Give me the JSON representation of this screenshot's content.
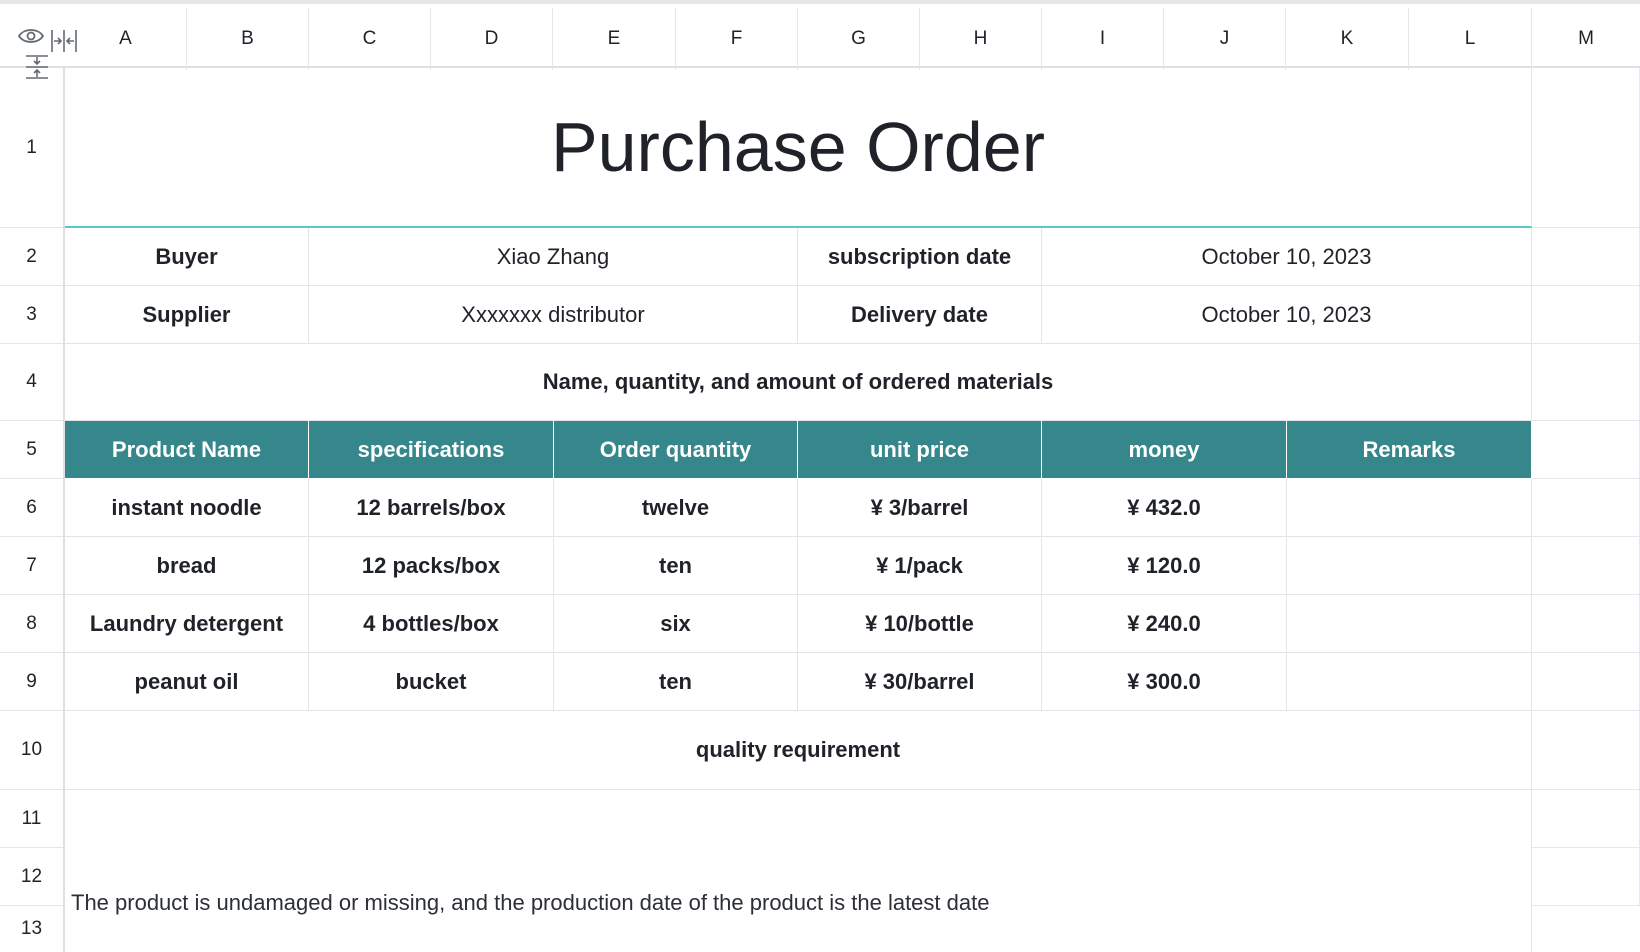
{
  "columns": [
    "A",
    "B",
    "C",
    "D",
    "E",
    "F",
    "G",
    "H",
    "I",
    "J",
    "K",
    "L",
    "M"
  ],
  "rows": [
    "1",
    "2",
    "3",
    "4",
    "5",
    "6",
    "7",
    "8",
    "9",
    "10",
    "11",
    "12",
    "13"
  ],
  "title": "Purchase Order",
  "info": {
    "buyer_label": "Buyer",
    "buyer_value": "Xiao Zhang",
    "subscription_label": "subscription date",
    "subscription_value": "October 10, 2023",
    "supplier_label": "Supplier",
    "supplier_value": "Xxxxxxx distributor",
    "delivery_label": "Delivery date",
    "delivery_value": "October 10, 2023"
  },
  "section_materials": "Name, quantity, and amount of ordered materials",
  "table": {
    "headers": [
      "Product Name",
      "specifications",
      "Order quantity",
      "unit price",
      "money",
      "Remarks"
    ],
    "rows": [
      [
        "instant noodle",
        "12 barrels/box",
        "twelve",
        "¥ 3/barrel",
        "¥ 432.0",
        ""
      ],
      [
        "bread",
        "12 packs/box",
        "ten",
        "¥ 1/pack",
        "¥ 120.0",
        ""
      ],
      [
        "Laundry detergent",
        "4 bottles/box",
        "six",
        "¥ 10/bottle",
        "¥ 240.0",
        ""
      ],
      [
        "peanut oil",
        "bucket",
        "ten",
        "¥ 30/barrel",
        "¥ 300.0",
        ""
      ]
    ]
  },
  "section_quality": "quality requirement",
  "quality_note": "The product is undamaged or missing, and the production date of the product is the latest date",
  "icons": {
    "visibility": "eye-icon",
    "collapse_columns": "collapse-columns-icon",
    "collapse_rows": "collapse-rows-icon"
  },
  "colors": {
    "header_fill": "#35878c",
    "title_underline": "#56c9cf"
  }
}
